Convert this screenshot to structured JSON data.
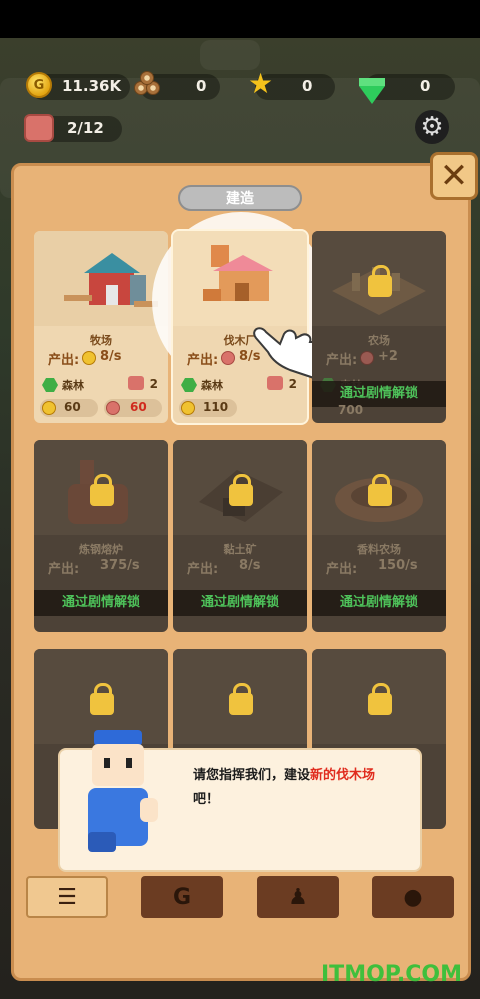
{
  "resources": {
    "gold": "11.36K",
    "wood": "0",
    "stars": "0",
    "gems": "0",
    "workers": "2/12"
  },
  "panel": {
    "title": "建造",
    "close_icon": "close-icon"
  },
  "cards": [
    {
      "name": "牧场",
      "output_label": "产出:",
      "output_value": "8/s",
      "terrain": "森林",
      "req_num": "2",
      "cost_gold": "60",
      "cost_other": "60",
      "locked": false
    },
    {
      "name": "伐木厂",
      "output_label": "产出:",
      "output_value": "8/s",
      "terrain": "森林",
      "req_num": "2",
      "cost_gold": "110",
      "locked": false,
      "highlighted": true
    },
    {
      "name": "农场",
      "output_label": "产出:",
      "output_value": "+2",
      "terrain": "森林",
      "cost_gold": "700",
      "locked": true,
      "lock_text": "通过剧情解锁"
    },
    {
      "name": "炼钢熔炉",
      "output_label": "产出:",
      "output_value": "375/s",
      "locked": true,
      "lock_text": "通过剧情解锁"
    },
    {
      "name": "黏土矿",
      "output_label": "产出:",
      "output_value": "8/s",
      "locked": true,
      "lock_text": "通过剧情解锁"
    },
    {
      "name": "香料农场",
      "output_label": "产出:",
      "output_value": "150/s",
      "locked": true,
      "lock_text": "通过剧情解锁"
    }
  ],
  "dialog": {
    "text_before": "请您指挥我们，建设",
    "text_highlight": "新的伐木场",
    "text_after": "吧！"
  },
  "tabs": [
    {
      "icon": "list-icon",
      "glyph": "☰",
      "active": true
    },
    {
      "icon": "gold-coin-icon",
      "glyph": "G",
      "active": false
    },
    {
      "icon": "bag-icon",
      "glyph": "♟",
      "active": false
    },
    {
      "icon": "person-icon",
      "glyph": "●",
      "active": false
    }
  ],
  "watermark": "ITMOP.COM",
  "colors": {
    "unlock_text": "#4ec25a",
    "dialog_highlight": "#e02c1e",
    "panel": "#e8b377"
  }
}
